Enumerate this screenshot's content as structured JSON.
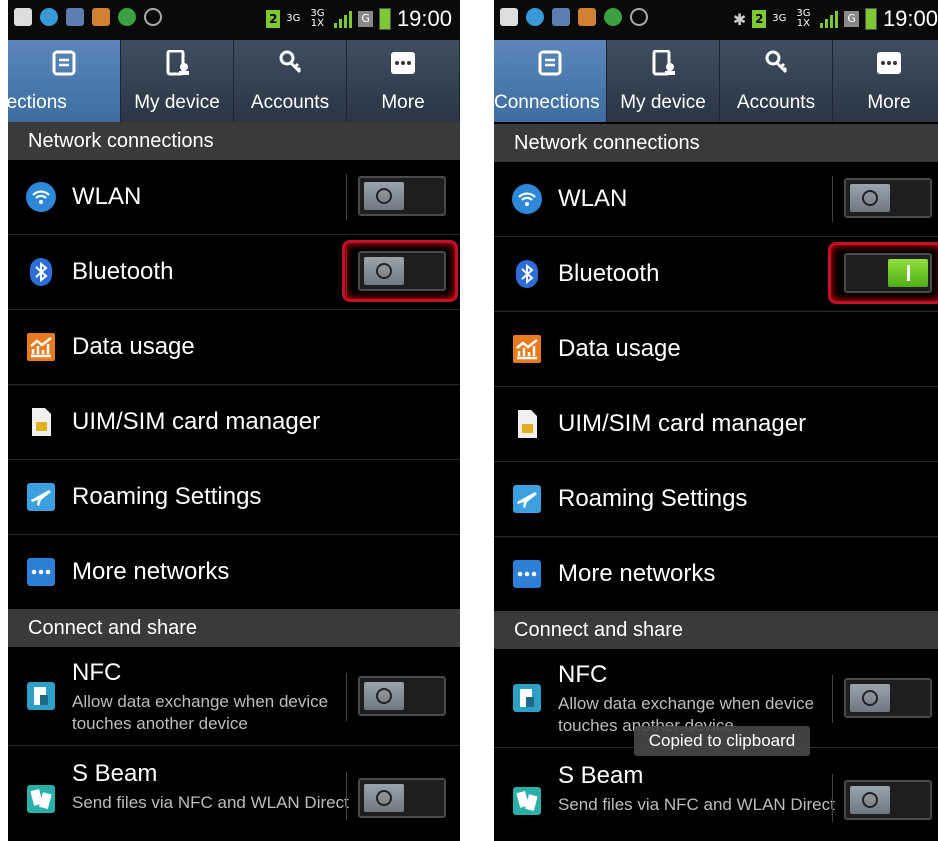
{
  "screens": [
    {
      "status_time": "19:00",
      "status_badge": "2",
      "status_net": "3G",
      "status_net2": "3G 1X",
      "status_g": "G",
      "tabs": [
        {
          "label": "nections",
          "icon": "connections-icon"
        },
        {
          "label": "My device",
          "icon": "my-device-icon"
        },
        {
          "label": "Accounts",
          "icon": "accounts-icon"
        },
        {
          "label": "More",
          "icon": "more-icon"
        }
      ],
      "section_network": "Network connections",
      "wlan_label": "WLAN",
      "wlan_toggle": "off",
      "bluetooth_label": "Bluetooth",
      "bluetooth_toggle": "off",
      "data_usage_label": "Data usage",
      "sim_label": "UIM/SIM card manager",
      "roaming_label": "Roaming Settings",
      "more_networks_label": "More networks",
      "section_share": "Connect and share",
      "nfc_label": "NFC",
      "nfc_sub": "Allow data exchange when device touches another device",
      "nfc_toggle": "off",
      "sbeam_label": "S Beam",
      "sbeam_sub": "Send files via NFC and WLAN Direct",
      "sbeam_toggle": "off"
    },
    {
      "status_time": "19:00",
      "status_badge": "2",
      "status_net": "3G",
      "status_net2": "3G 1X",
      "status_g": "G",
      "tabs": [
        {
          "label": "Connections",
          "icon": "connections-icon"
        },
        {
          "label": "My device",
          "icon": "my-device-icon"
        },
        {
          "label": "Accounts",
          "icon": "accounts-icon"
        },
        {
          "label": "More",
          "icon": "more-icon"
        }
      ],
      "section_network": "Network connections",
      "wlan_label": "WLAN",
      "wlan_toggle": "off",
      "bluetooth_label": "Bluetooth",
      "bluetooth_toggle": "on",
      "data_usage_label": "Data usage",
      "sim_label": "UIM/SIM card manager",
      "roaming_label": "Roaming Settings",
      "more_networks_label": "More networks",
      "section_share": "Connect and share",
      "nfc_label": "NFC",
      "nfc_sub": "Allow data exchange when device touches another device",
      "nfc_toggle": "off",
      "sbeam_label": "S Beam",
      "sbeam_sub": "Send files via NFC and WLAN Direct",
      "sbeam_toggle": "off",
      "toast": "Copied to clipboard"
    }
  ],
  "colors": {
    "active_tab": "#4a7bb0",
    "toggle_on": "#6cc82a",
    "highlight": "#c0102a",
    "section_bg": "#3a3a3a"
  }
}
